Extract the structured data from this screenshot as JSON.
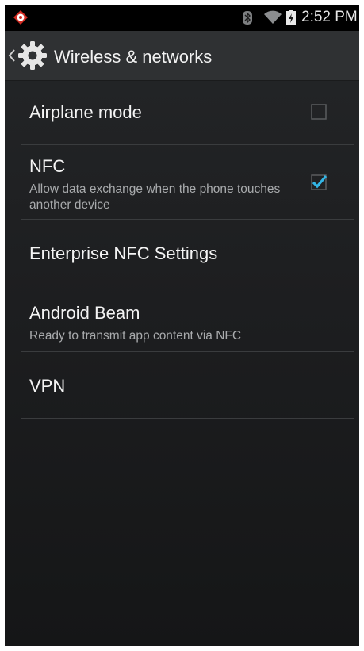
{
  "status_bar": {
    "time": "2:52 PM",
    "icons": [
      "app-notification-icon",
      "bluetooth-icon",
      "wifi-icon",
      "battery-icon"
    ]
  },
  "action_bar": {
    "title": "Wireless & networks",
    "icons": [
      "up-caret-icon",
      "settings-gear-icon"
    ]
  },
  "preferences": [
    {
      "title": "Airplane mode",
      "summary": "",
      "checkbox": true,
      "checked": false
    },
    {
      "title": "NFC",
      "summary": "Allow data exchange when the phone touches another device",
      "checkbox": true,
      "checked": true
    },
    {
      "title": "Enterprise NFC Settings",
      "summary": "",
      "checkbox": false
    },
    {
      "title": "Android Beam",
      "summary": "Ready to transmit app content via NFC",
      "checkbox": false
    },
    {
      "title": "VPN",
      "summary": "",
      "checkbox": false
    }
  ],
  "colors": {
    "accent": "#33b5e5",
    "background": "#1e1f21",
    "action_bar": "#2f3133",
    "status_bar": "#000000"
  }
}
